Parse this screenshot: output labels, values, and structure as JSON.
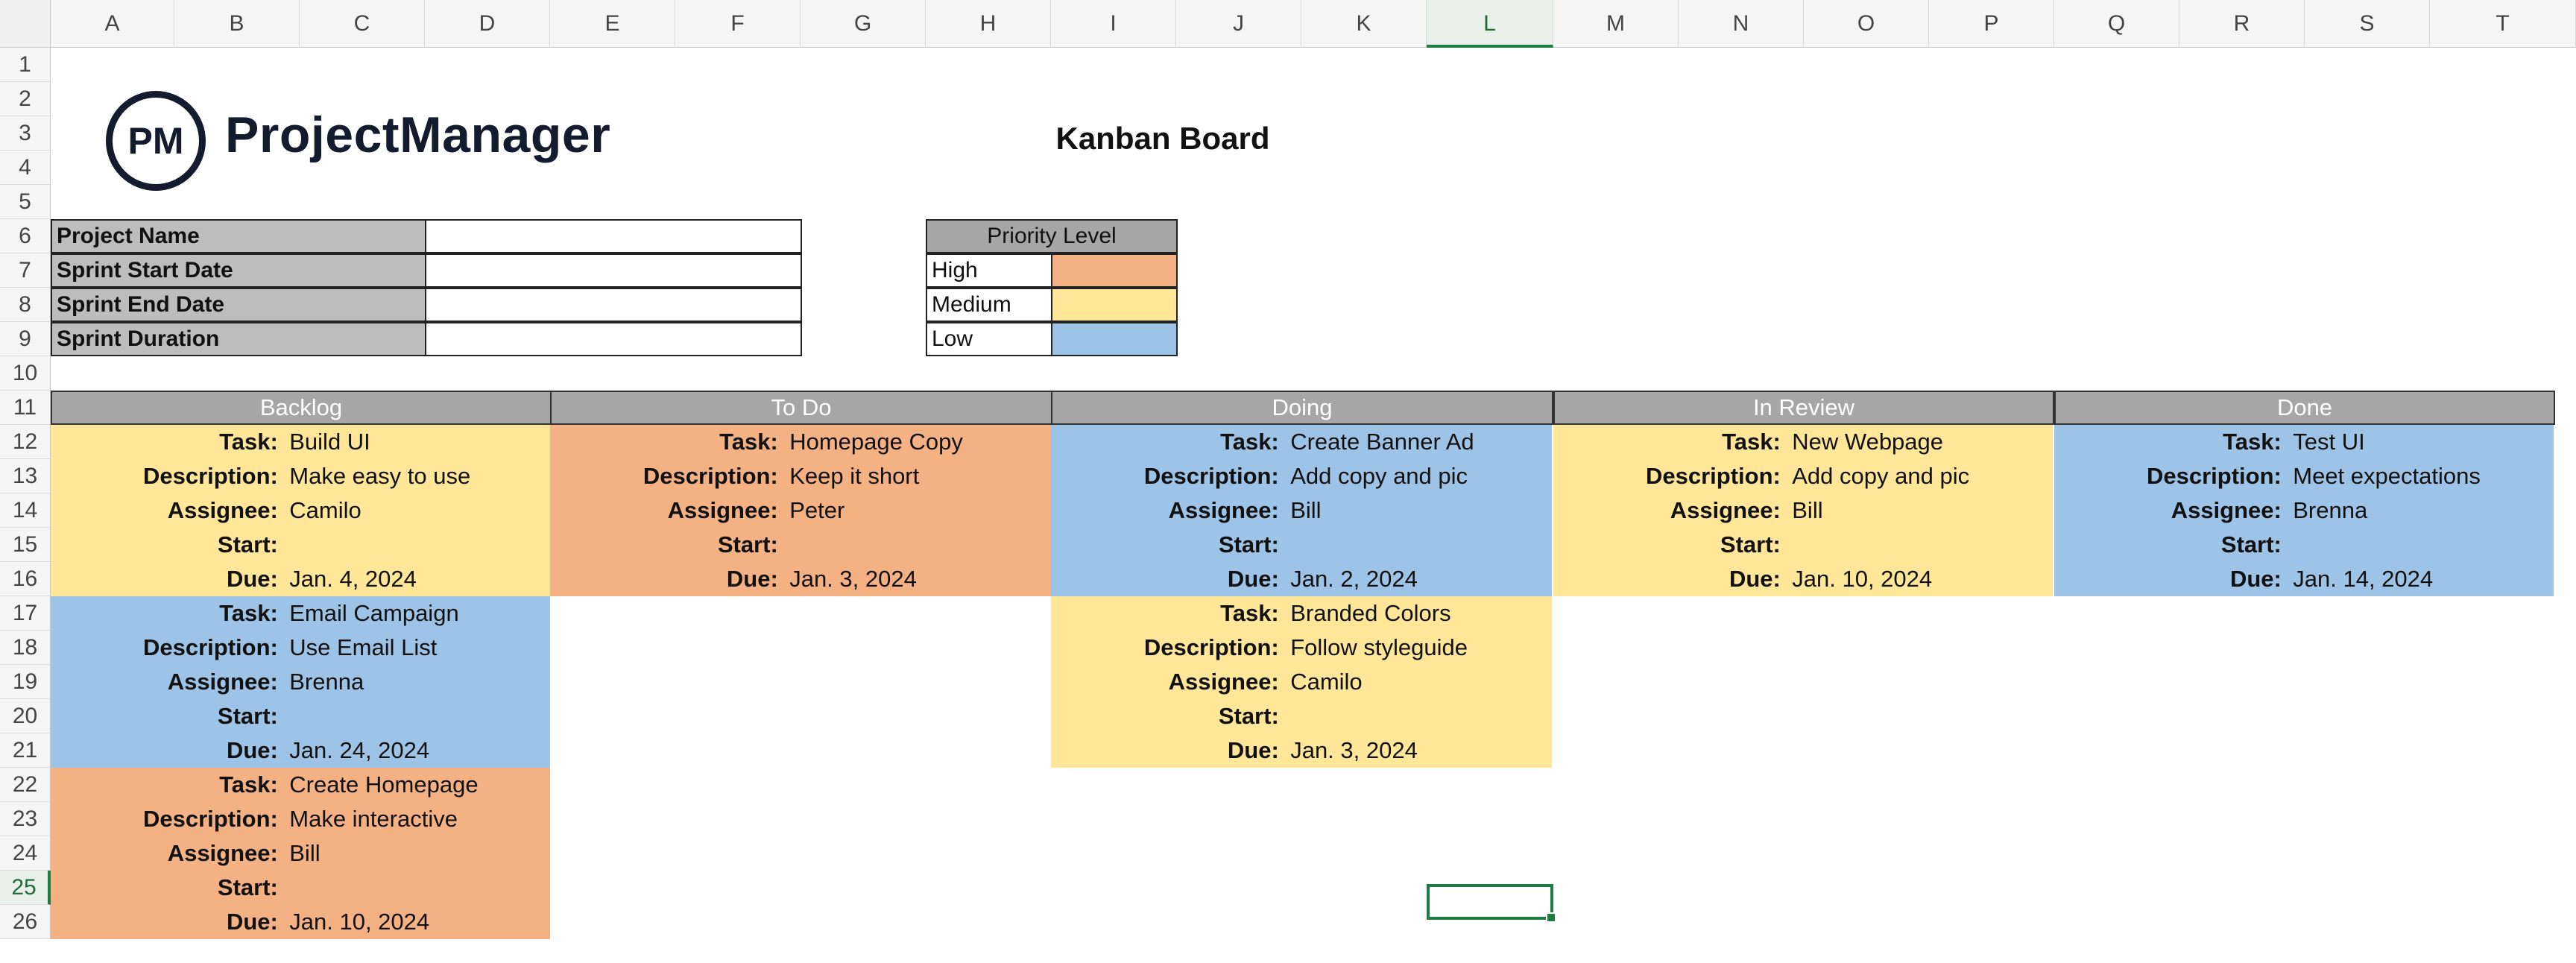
{
  "columns": [
    "A",
    "B",
    "C",
    "D",
    "E",
    "F",
    "G",
    "H",
    "I",
    "J",
    "K",
    "L",
    "M",
    "N",
    "O",
    "P",
    "Q",
    "R",
    "S",
    "T"
  ],
  "selected_column": "L",
  "rows": [
    "1",
    "2",
    "3",
    "4",
    "5",
    "6",
    "7",
    "8",
    "9",
    "10",
    "11",
    "12",
    "13",
    "14",
    "15",
    "16",
    "17",
    "18",
    "19",
    "20",
    "21",
    "22",
    "23",
    "24",
    "25",
    "26"
  ],
  "selected_row": "25",
  "logo": {
    "mark": "PM",
    "name": "ProjectManager"
  },
  "title": "Kanban Board",
  "info": [
    {
      "label": "Project Name",
      "value": ""
    },
    {
      "label": "Sprint Start Date",
      "value": ""
    },
    {
      "label": "Sprint End Date",
      "value": ""
    },
    {
      "label": "Sprint Duration",
      "value": ""
    }
  ],
  "priority": {
    "header": "Priority Level",
    "levels": [
      {
        "label": "High",
        "color": "#f4b183"
      },
      {
        "label": "Medium",
        "color": "#ffe699"
      },
      {
        "label": "Low",
        "color": "#9dc3e6"
      }
    ]
  },
  "field_labels": {
    "task": "Task:",
    "description": "Description:",
    "assignee": "Assignee:",
    "start": "Start:",
    "due": "Due:"
  },
  "board": [
    {
      "name": "Backlog",
      "cards": [
        {
          "priority": "Medium",
          "task": "Build UI",
          "description": "Make easy to use",
          "assignee": "Camilo",
          "start": "",
          "due": "Jan. 4, 2024"
        },
        {
          "priority": "Low",
          "task": "Email Campaign",
          "description": "Use Email List",
          "assignee": "Brenna",
          "start": "",
          "due": "Jan. 24, 2024"
        },
        {
          "priority": "High",
          "task": "Create Homepage",
          "description": "Make interactive",
          "assignee": "Bill",
          "start": "",
          "due": "Jan. 10, 2024"
        }
      ]
    },
    {
      "name": "To Do",
      "cards": [
        {
          "priority": "High",
          "task": "Homepage Copy",
          "description": "Keep it short",
          "assignee": "Peter",
          "start": "",
          "due": "Jan. 3, 2024"
        }
      ]
    },
    {
      "name": "Doing",
      "cards": [
        {
          "priority": "Low",
          "task": "Create Banner Ad",
          "description": "Add copy and pic",
          "assignee": "Bill",
          "start": "",
          "due": "Jan. 2, 2024"
        },
        {
          "priority": "Medium",
          "task": "Branded Colors",
          "description": "Follow styleguide",
          "assignee": "Camilo",
          "start": "",
          "due": "Jan. 3, 2024"
        }
      ]
    },
    {
      "name": "In Review",
      "cards": [
        {
          "priority": "Medium",
          "task": "New Webpage",
          "description": "Add copy and pic",
          "assignee": "Bill",
          "start": "",
          "due": "Jan. 10, 2024"
        }
      ]
    },
    {
      "name": "Done",
      "cards": [
        {
          "priority": "Low",
          "task": "Test UI",
          "description": "Meet expectations",
          "assignee": "Brenna",
          "start": "",
          "due": "Jan. 14, 2024"
        }
      ]
    }
  ]
}
